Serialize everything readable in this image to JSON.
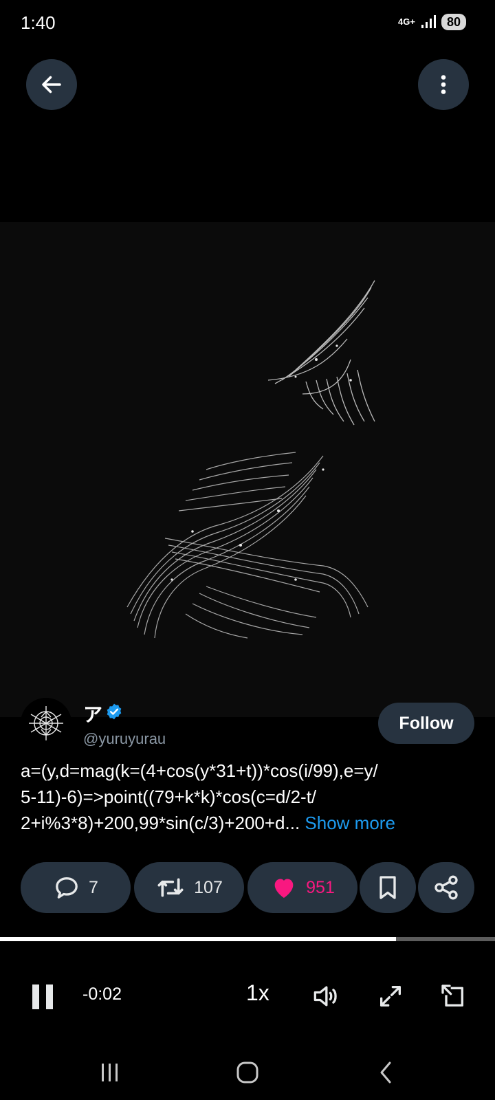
{
  "status_bar": {
    "time": "1:40",
    "network": "4G+",
    "battery": "80"
  },
  "author": {
    "name": "ア",
    "handle": "@yuruyurau",
    "verified": true,
    "follow_label": "Follow"
  },
  "tweet": {
    "lines": [
      "a=(y,d=mag(k=(4+cos(y*31+t))*cos(i/99),e=y/",
      "5-11)-6)=>point((79+k*k)*cos(c=d/2-t/",
      "2+i%3*8)+200,99*sin(c/3)+200+d..."
    ],
    "show_more": "Show more"
  },
  "actions": {
    "replies": "7",
    "retweets": "107",
    "likes": "951",
    "liked": true
  },
  "player": {
    "progress": 0.8,
    "time_remaining": "-0:02",
    "speed": "1x"
  },
  "colors": {
    "accent": "#1d9bf0",
    "like": "#f91880",
    "pill_bg": "#273340"
  },
  "icons": {
    "back": "arrow-left-icon",
    "more": "more-vertical-icon",
    "reply": "reply-icon",
    "retweet": "retweet-icon",
    "like": "heart-icon",
    "bookmark": "bookmark-icon",
    "share": "share-icon",
    "pause": "pause-icon",
    "volume": "volume-icon",
    "fullscreen": "fullscreen-icon",
    "pip": "pip-icon"
  }
}
